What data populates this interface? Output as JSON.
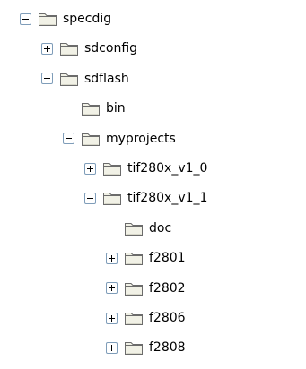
{
  "tree": {
    "nodes": [
      {
        "label": "specdig",
        "depth": 0,
        "expander": "minus"
      },
      {
        "label": "sdconfig",
        "depth": 1,
        "expander": "plus"
      },
      {
        "label": "sdflash",
        "depth": 1,
        "expander": "minus"
      },
      {
        "label": "bin",
        "depth": 2,
        "expander": "none"
      },
      {
        "label": "myprojects",
        "depth": 2,
        "expander": "minus"
      },
      {
        "label": "tif280x_v1_0",
        "depth": 3,
        "expander": "plus"
      },
      {
        "label": "tif280x_v1_1",
        "depth": 3,
        "expander": "minus"
      },
      {
        "label": "doc",
        "depth": 4,
        "expander": "none"
      },
      {
        "label": "f2801",
        "depth": 4,
        "expander": "plus"
      },
      {
        "label": "f2802",
        "depth": 4,
        "expander": "plus"
      },
      {
        "label": "f2806",
        "depth": 4,
        "expander": "plus"
      },
      {
        "label": "f2808",
        "depth": 4,
        "expander": "plus"
      }
    ]
  },
  "colors": {
    "expander_border": "#7f9db9",
    "folder_fill": "#f1f1e6",
    "folder_stroke": "#6b6b6b"
  }
}
